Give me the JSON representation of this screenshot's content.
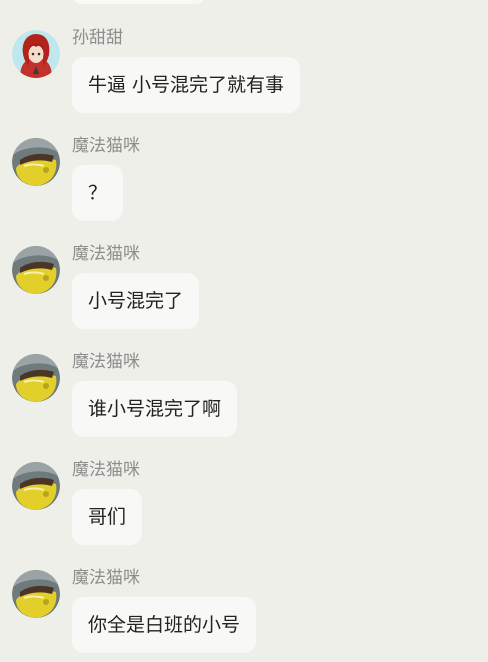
{
  "messages": [
    {
      "sender": "孙甜甜",
      "text": "牛逼  小号混完了就有事",
      "avatar": "red-hair-girl-avatar"
    },
    {
      "sender": "魔法猫咪",
      "text": "？",
      "avatar": "yellow-cat-avatar"
    },
    {
      "sender": "魔法猫咪",
      "text": "小号混完了",
      "avatar": "yellow-cat-avatar"
    },
    {
      "sender": "魔法猫咪",
      "text": "谁小号混完了啊",
      "avatar": "yellow-cat-avatar"
    },
    {
      "sender": "魔法猫咪",
      "text": "哥们",
      "avatar": "yellow-cat-avatar"
    },
    {
      "sender": "魔法猫咪",
      "text": "你全是白班的小号",
      "avatar": "yellow-cat-avatar"
    }
  ],
  "colors": {
    "background": "#efefea",
    "bubble": "#f8f8f6",
    "sender_name": "#8d8d8d",
    "message_text": "#222222"
  }
}
